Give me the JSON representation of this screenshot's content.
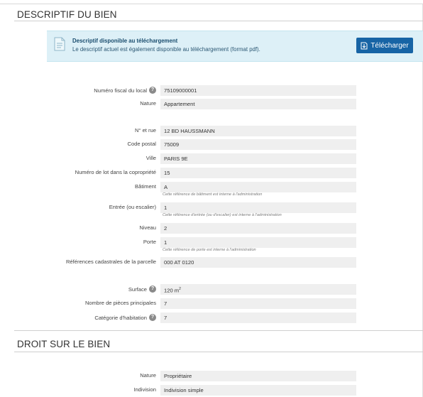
{
  "sections": {
    "descriptif_title": "DESCRIPTIF DU BIEN",
    "droit_title": "DROIT SUR LE BIEN"
  },
  "download_box": {
    "icon": "document-icon",
    "title": "Descriptif disponible au téléchargement",
    "description": "Le descriptif actuel est également disponible au téléchargement (format pdf).",
    "button_label": "Télécharger",
    "button_icon": "download-icon",
    "button_color": "#1764a5",
    "background": "#ddf0f7"
  },
  "fields": {
    "numero_fiscal": {
      "label": "Numéro fiscal du local",
      "value": "75109000001",
      "help": "?"
    },
    "nature": {
      "label": "Nature",
      "value": "Appartement"
    },
    "rue": {
      "label": "N° et rue",
      "value": "12 BD HAUSSMANN"
    },
    "code_postal": {
      "label": "Code postal",
      "value": "75009"
    },
    "ville": {
      "label": "Ville",
      "value": "PARIS 9E"
    },
    "numero_lot": {
      "label": "Numéro de lot dans la copropriété",
      "value": "15"
    },
    "batiment": {
      "label": "Bâtiment",
      "value": "A",
      "note": "Cette référence de bâtiment est interne à l'administration"
    },
    "entree": {
      "label": "Entrée (ou escalier)",
      "value": "1",
      "note": "Cette référence d'entrée (ou d'escalier) est interne à l'administration"
    },
    "niveau": {
      "label": "Niveau",
      "value": "2"
    },
    "porte": {
      "label": "Porte",
      "value": "1",
      "note": "Cette référence de porte est interne à l'administration"
    },
    "references_cadastrales": {
      "label": "Références cadastrales de la parcelle",
      "value": "000 AT 0120"
    },
    "surface": {
      "label": "Surface",
      "value": "120 m",
      "unit_sup": "2",
      "help": "?"
    },
    "pieces": {
      "label": "Nombre de pièces principales",
      "value": "7"
    },
    "categorie": {
      "label": "Catégorie d'habitation",
      "value": "7",
      "help": "?"
    }
  },
  "droit_fields": {
    "nature": {
      "label": "Nature",
      "value": "Propriétaire"
    },
    "indivision": {
      "label": "Indivision",
      "value": "Indivision simple"
    }
  }
}
